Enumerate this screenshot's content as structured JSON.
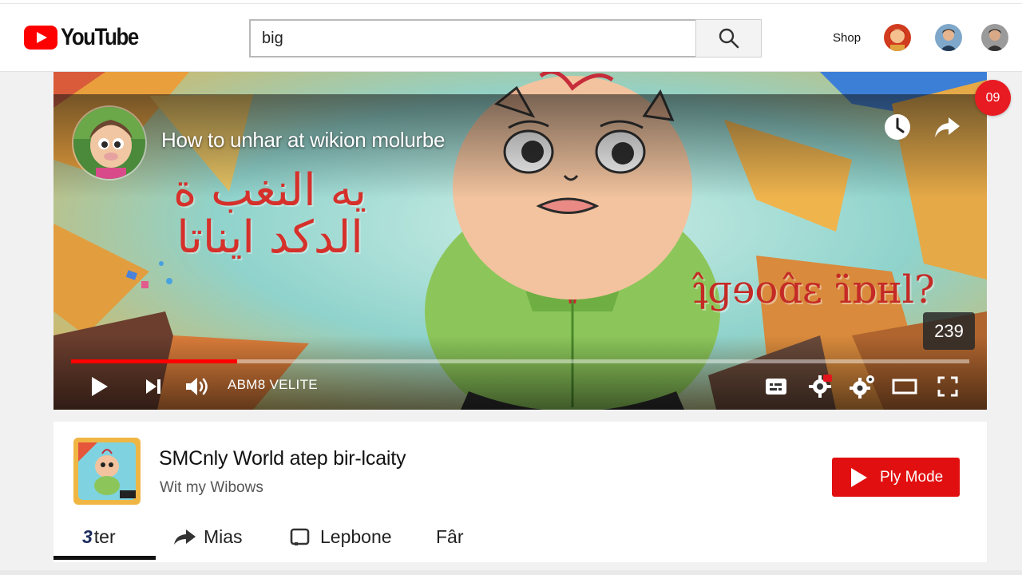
{
  "header": {
    "logo_text": "YouTube",
    "search_value": "big",
    "shop_label": "Shop"
  },
  "player": {
    "title": "How to unhar at wikion molurbe",
    "overlay_text_1": "يه النغب ة",
    "overlay_text_2": "الدكد ايناتا",
    "overlay_text_3": "ʇ̂ɡɘoɑ̂ɛ ɿ̈ɒʜl?",
    "time_badge": "239",
    "control_label": "ABM8 VELITE",
    "progress_fraction": 0.185
  },
  "notification_badge": "09",
  "video_info": {
    "title": "SMCnly World atep bir-lcaity",
    "subtitle": "Wit my Wibows",
    "play_mode_label": "Ply Mode"
  },
  "tabs": [
    {
      "label": "ter",
      "prefix": "3"
    },
    {
      "label": "Mias"
    },
    {
      "label": "Lepbone"
    },
    {
      "label": "Fâr"
    }
  ],
  "colors": {
    "brand_red": "#ff0000",
    "button_red": "#e10f0f",
    "badge_red": "#e81b23"
  }
}
